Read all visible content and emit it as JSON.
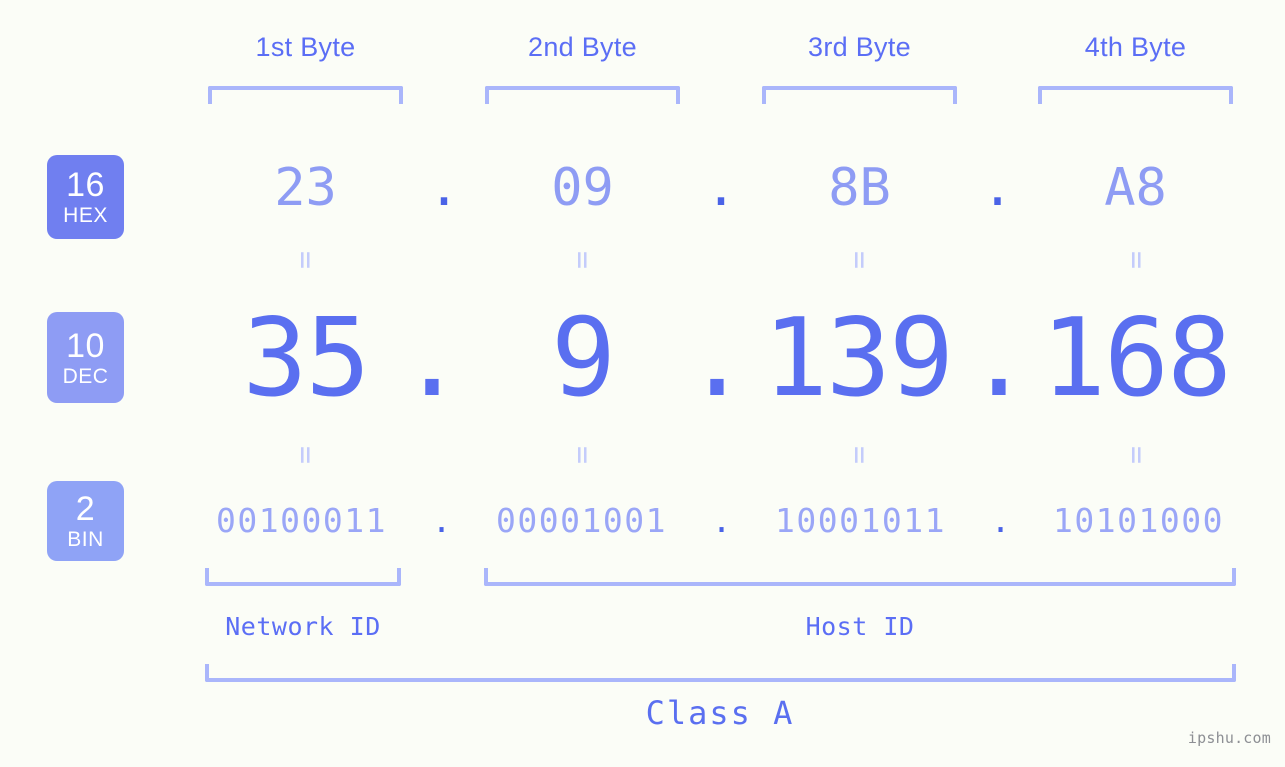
{
  "page": {
    "background_color": "#fbfdf7",
    "accent_color": "#5b6ef5",
    "accent_light_color": "#aab6fb",
    "watermark": "ipshu.com"
  },
  "byte_headers": [
    {
      "label": "1st Byte"
    },
    {
      "label": "2nd Byte"
    },
    {
      "label": "3rd Byte"
    },
    {
      "label": "4th Byte"
    }
  ],
  "bases": [
    {
      "number": "16",
      "name": "HEX",
      "color": "#707ff0"
    },
    {
      "number": "10",
      "name": "DEC",
      "color": "#8e9cf4"
    },
    {
      "number": "2",
      "name": "BIN",
      "color": "#8fa3f6"
    }
  ],
  "rows": {
    "hex": {
      "values": [
        "23",
        "09",
        "8B",
        "A8"
      ],
      "separator": "."
    },
    "dec": {
      "values": [
        "35",
        "9",
        "139",
        "168"
      ],
      "separator": "."
    },
    "bin": {
      "values": [
        "00100011",
        "00001001",
        "10001011",
        "10101000"
      ],
      "separator": "."
    }
  },
  "equals": {
    "symbol": "="
  },
  "segments": {
    "network_id": "Network ID",
    "host_id": "Host ID"
  },
  "class": {
    "label": "Class A"
  }
}
